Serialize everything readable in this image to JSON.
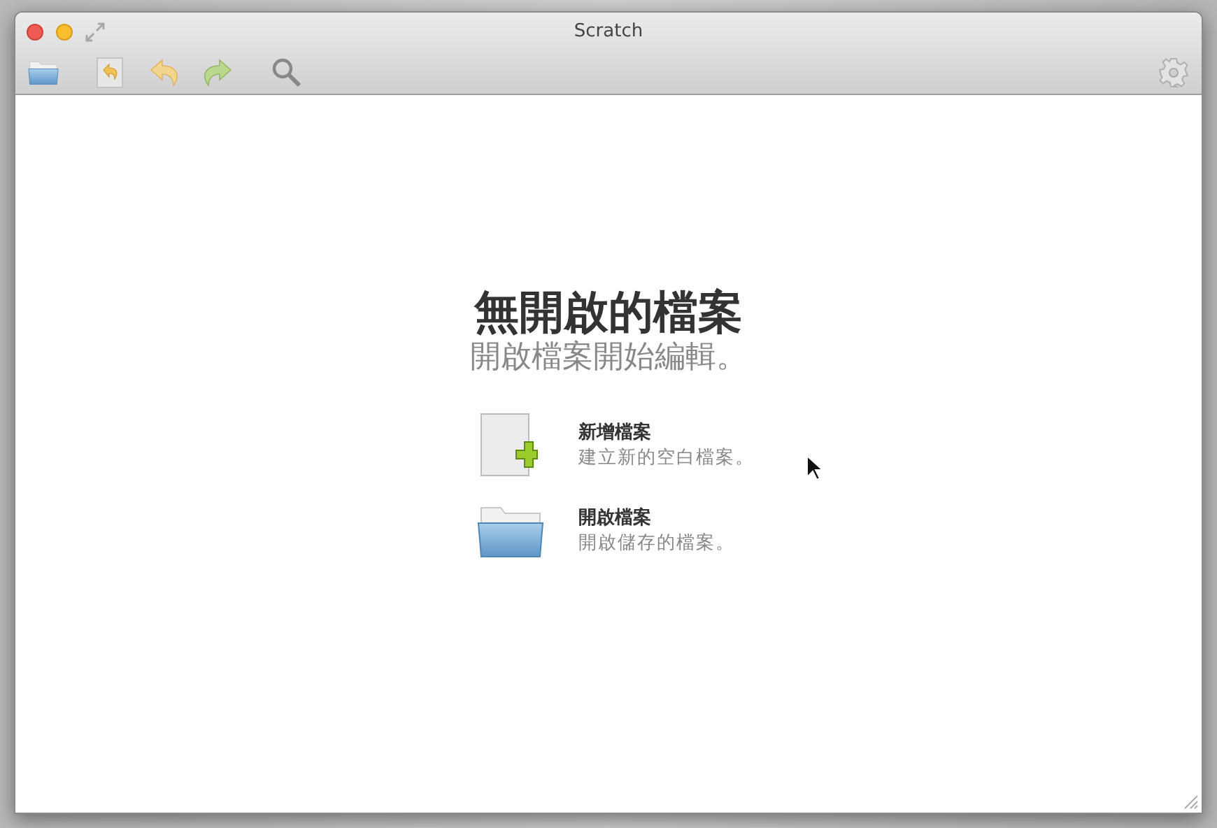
{
  "window": {
    "title": "Scratch"
  },
  "welcome": {
    "title": "無開啟的檔案",
    "subtitle": "開啟檔案開始編輯。",
    "actions": [
      {
        "kind": "new",
        "title": "新增檔案",
        "description": "建立新的空白檔案。"
      },
      {
        "kind": "open",
        "title": "開啟檔案",
        "description": "開啟儲存的檔案。"
      }
    ]
  }
}
